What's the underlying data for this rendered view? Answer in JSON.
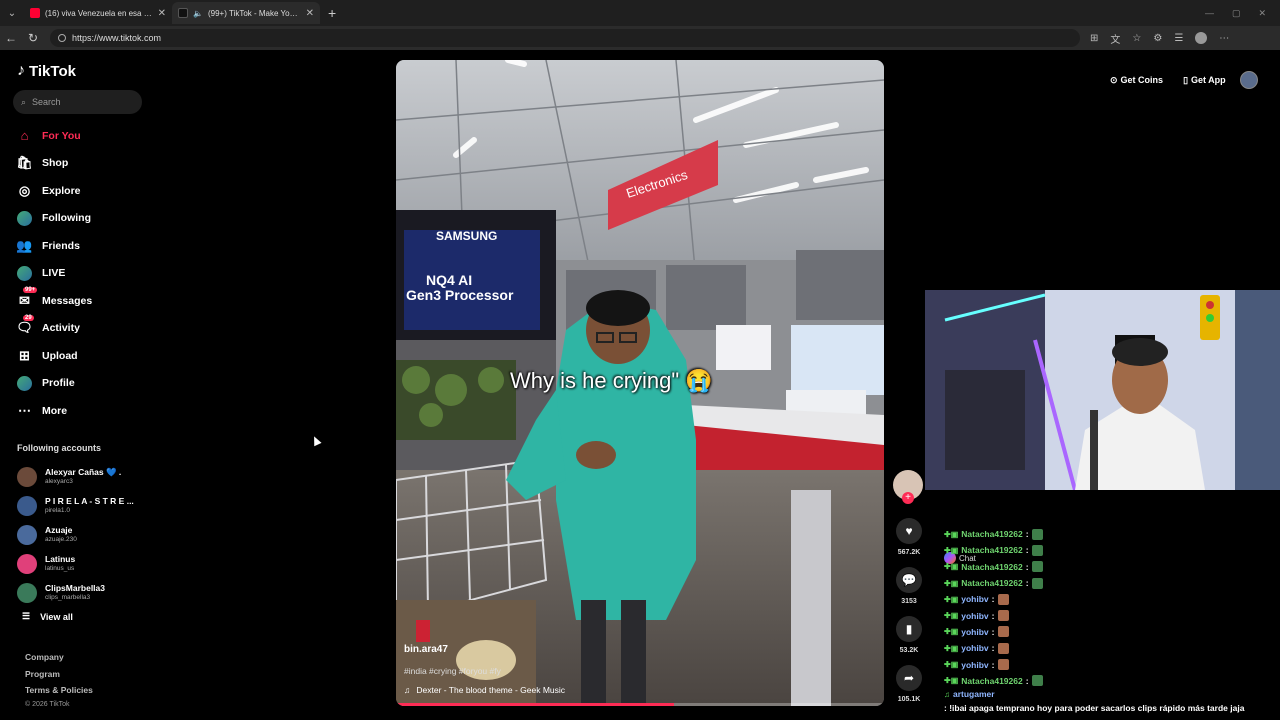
{
  "browser": {
    "tabs": [
      {
        "title": "(16) viva Venezuela en esa mierda",
        "close": "✕"
      },
      {
        "title": "(99+) TikTok - Make Your Day",
        "close": "✕"
      }
    ],
    "new_tab": "+",
    "url": "https://www.tiktok.com",
    "chat_label": "Chat"
  },
  "tiktok": {
    "logo": "TikTok",
    "search_placeholder": "Search",
    "nav": [
      {
        "label": "For You",
        "icon": "home-icon"
      },
      {
        "label": "Shop",
        "icon": "shop-icon"
      },
      {
        "label": "Explore",
        "icon": "compass-icon"
      },
      {
        "label": "Following",
        "icon": "following-avatar-icon"
      },
      {
        "label": "Friends",
        "icon": "friends-icon"
      },
      {
        "label": "LIVE",
        "icon": "live-avatar-icon"
      },
      {
        "label": "Messages",
        "icon": "messages-icon",
        "badge": "99+"
      },
      {
        "label": "Activity",
        "icon": "activity-icon",
        "badge": "29"
      },
      {
        "label": "Upload",
        "icon": "upload-icon"
      },
      {
        "label": "Profile",
        "icon": "profile-avatar-icon"
      },
      {
        "label": "More",
        "icon": "more-icon"
      }
    ],
    "following_title": "Following accounts",
    "accounts": [
      {
        "name": "Alexyar Cañas 💙 .",
        "handle": "alexyarc3",
        "color": "#6b4a3a"
      },
      {
        "name": "P I R E L A - S T R E ...",
        "handle": "pirela1.0",
        "color": "#3a5a8c"
      },
      {
        "name": "Azuaje",
        "handle": "azuaje.230",
        "color": "#4a6a9c"
      },
      {
        "name": "Latinus",
        "handle": "latinus_us",
        "color": "#e0407a"
      },
      {
        "name": "ClipsMarbella3",
        "handle": "clips_marbella3",
        "color": "#3a7a5a"
      }
    ],
    "view_all": "View all",
    "footer": [
      "Company",
      "Program",
      "Terms & Policies"
    ],
    "copyright": "© 2026 TikTok",
    "top_right": {
      "coins": "Get Coins",
      "app": "Get App"
    }
  },
  "video": {
    "caption": "Why is he crying\"",
    "caption_emoji": "😭",
    "author": "bin.ara47",
    "tags": "#india #crying #foryou #fy",
    "music": "Dexter - The blood theme - Geek Music",
    "progress": 0.57,
    "scene_text": {
      "store_sign": "Electronics",
      "tv_brand": "SAMSUNG",
      "tv_line1": "NQ4 AI",
      "tv_line2": "Gen3 Processor"
    },
    "likes": "567.2K",
    "comments": "3153",
    "saves": "53.2K",
    "shares": "105.1K"
  },
  "chat": [
    {
      "user": "Natacha419262",
      "sep": ":",
      "type": "emote"
    },
    {
      "user": "Natacha419262",
      "sep": ":",
      "type": "emote"
    },
    {
      "user": "Natacha419262",
      "sep": ":",
      "type": "emote"
    },
    {
      "user": "Natacha419262",
      "sep": ":",
      "type": "emote"
    },
    {
      "user": "yohibv",
      "sep": ":",
      "type": "pic",
      "blue": true
    },
    {
      "user": "yohibv",
      "sep": ":",
      "type": "pic",
      "blue": true
    },
    {
      "user": "yohibv",
      "sep": ":",
      "type": "pic",
      "blue": true
    },
    {
      "user": "yohibv",
      "sep": ":",
      "type": "pic",
      "blue": true
    },
    {
      "user": "yohibv",
      "sep": ":",
      "type": "pic",
      "blue": true
    },
    {
      "user": "Natacha419262",
      "sep": ":",
      "type": "emote"
    }
  ],
  "chat_last": {
    "user": "artugamer",
    "text": ": !ibai apaga temprano hoy para poder sacarlos clips rápido más tarde jaja"
  },
  "colors": {
    "accent": "#fe2c55",
    "chat_user": "#6fd36f"
  }
}
